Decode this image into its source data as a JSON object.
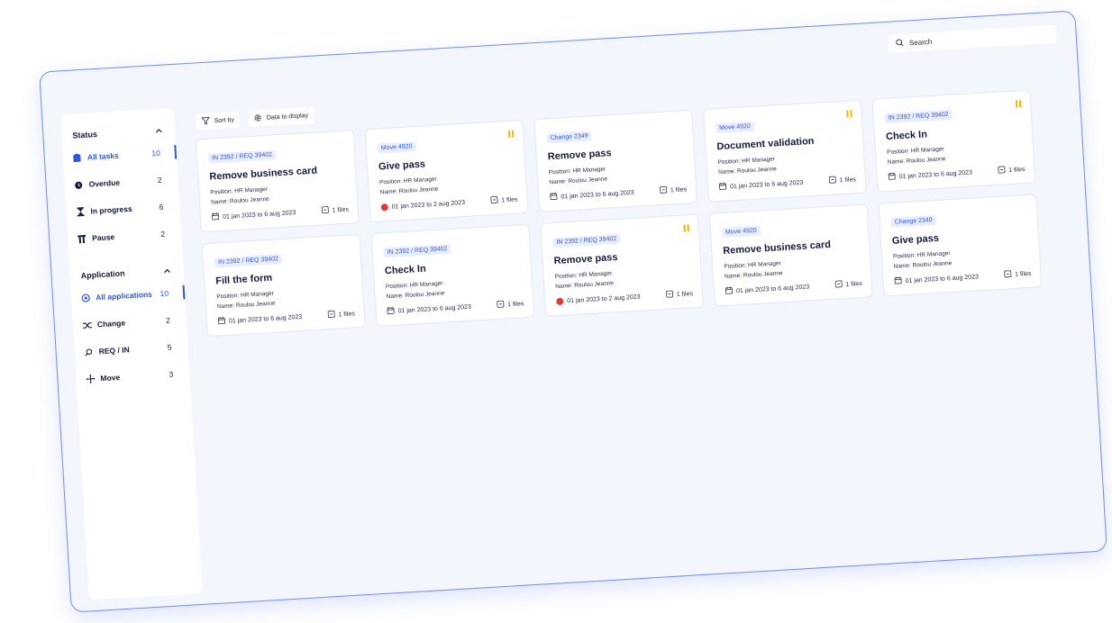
{
  "search": {
    "placeholder": "Search"
  },
  "toolbar": {
    "sort_label": "Sort by",
    "display_label": "Data to display"
  },
  "sidebar": {
    "status_heading": "Status",
    "status_items": [
      {
        "label": "All tasks",
        "count": "10",
        "icon": "clipboard-icon"
      },
      {
        "label": "Overdue",
        "count": "2",
        "icon": "clock-icon"
      },
      {
        "label": "In progress",
        "count": "6",
        "icon": "hourglass-icon"
      },
      {
        "label": "Pause",
        "count": "2",
        "icon": "pause-icon"
      }
    ],
    "application_heading": "Application",
    "application_items": [
      {
        "label": "All applications",
        "count": "10",
        "icon": "target-icon"
      },
      {
        "label": "Change",
        "count": "2",
        "icon": "shuffle-icon"
      },
      {
        "label": "REQ / IN",
        "count": "5",
        "icon": "search-icon"
      },
      {
        "label": "Move",
        "count": "3",
        "icon": "move-icon"
      }
    ]
  },
  "card_labels": {
    "position": "Position:",
    "name": "Name:"
  },
  "cards": [
    {
      "tag": "IN 2392 / REQ 39402",
      "title": "Remove business card",
      "position": "HR Manager",
      "name": "Roulou Jeanne",
      "date": "01 jan 2023 to 6 aug 2023",
      "files": "1 files",
      "paused": false,
      "overdue": false
    },
    {
      "tag": "IN 2392 / REQ 39402",
      "title": "Fill the form",
      "position": "HR Manager",
      "name": "Roulou Jeanne",
      "date": "01 jan 2023 to 6 aug 2023",
      "files": "1 files",
      "paused": false,
      "overdue": false
    },
    {
      "tag": "Move 4920",
      "title": "Give pass",
      "position": "HR Manager",
      "name": "Roulou Jeanne",
      "date": "01 jan 2023 to 2 aug 2023",
      "files": "1 files",
      "paused": true,
      "overdue": true
    },
    {
      "tag": "IN 2392 / REQ 39402",
      "title": "Check In",
      "position": "HR Manager",
      "name": "Roulou Jeanne",
      "date": "01 jan 2023 to 6 aug 2023",
      "files": "1 files",
      "paused": false,
      "overdue": false
    },
    {
      "tag": "Change 2349",
      "title": "Remove pass",
      "position": "HR Manager",
      "name": "Roulou Jeanne",
      "date": "01 jan 2023 to 6 aug 2023",
      "files": "1 files",
      "paused": false,
      "overdue": false
    },
    {
      "tag": "IN 2392 / REQ 39402",
      "title": "Remove pass",
      "position": "HR Manager",
      "name": "Roulou Jeanne",
      "date": "01 jan 2023 to 2 aug 2023",
      "files": "1 files",
      "paused": true,
      "overdue": true
    },
    {
      "tag": "Move 4920",
      "title": "Document validation",
      "position": "HR Manager",
      "name": "Roulou Jeanne",
      "date": "01 jan 2023 to 6 aug 2023",
      "files": "1 files",
      "paused": true,
      "overdue": false
    },
    {
      "tag": "Move 4920",
      "title": "Remove business card",
      "position": "HR Manager",
      "name": "Roulou Jeanne",
      "date": "01 jan 2023 to 6 aug 2023",
      "files": "1 files",
      "paused": false,
      "overdue": false
    },
    {
      "tag": "IN 2392 / REQ 39402",
      "title": "Check In",
      "position": "HR Manager",
      "name": "Roulou Jeanne",
      "date": "01 jan 2023 to 6 aug 2023",
      "files": "1 files",
      "paused": true,
      "overdue": false
    },
    {
      "tag": "Change 2349",
      "title": "Give pass",
      "position": "HR Manager",
      "name": "Roulou Jeanne",
      "date": "01 jan 2023 to 6 aug 2023",
      "files": "1 files",
      "paused": false,
      "overdue": false
    }
  ]
}
